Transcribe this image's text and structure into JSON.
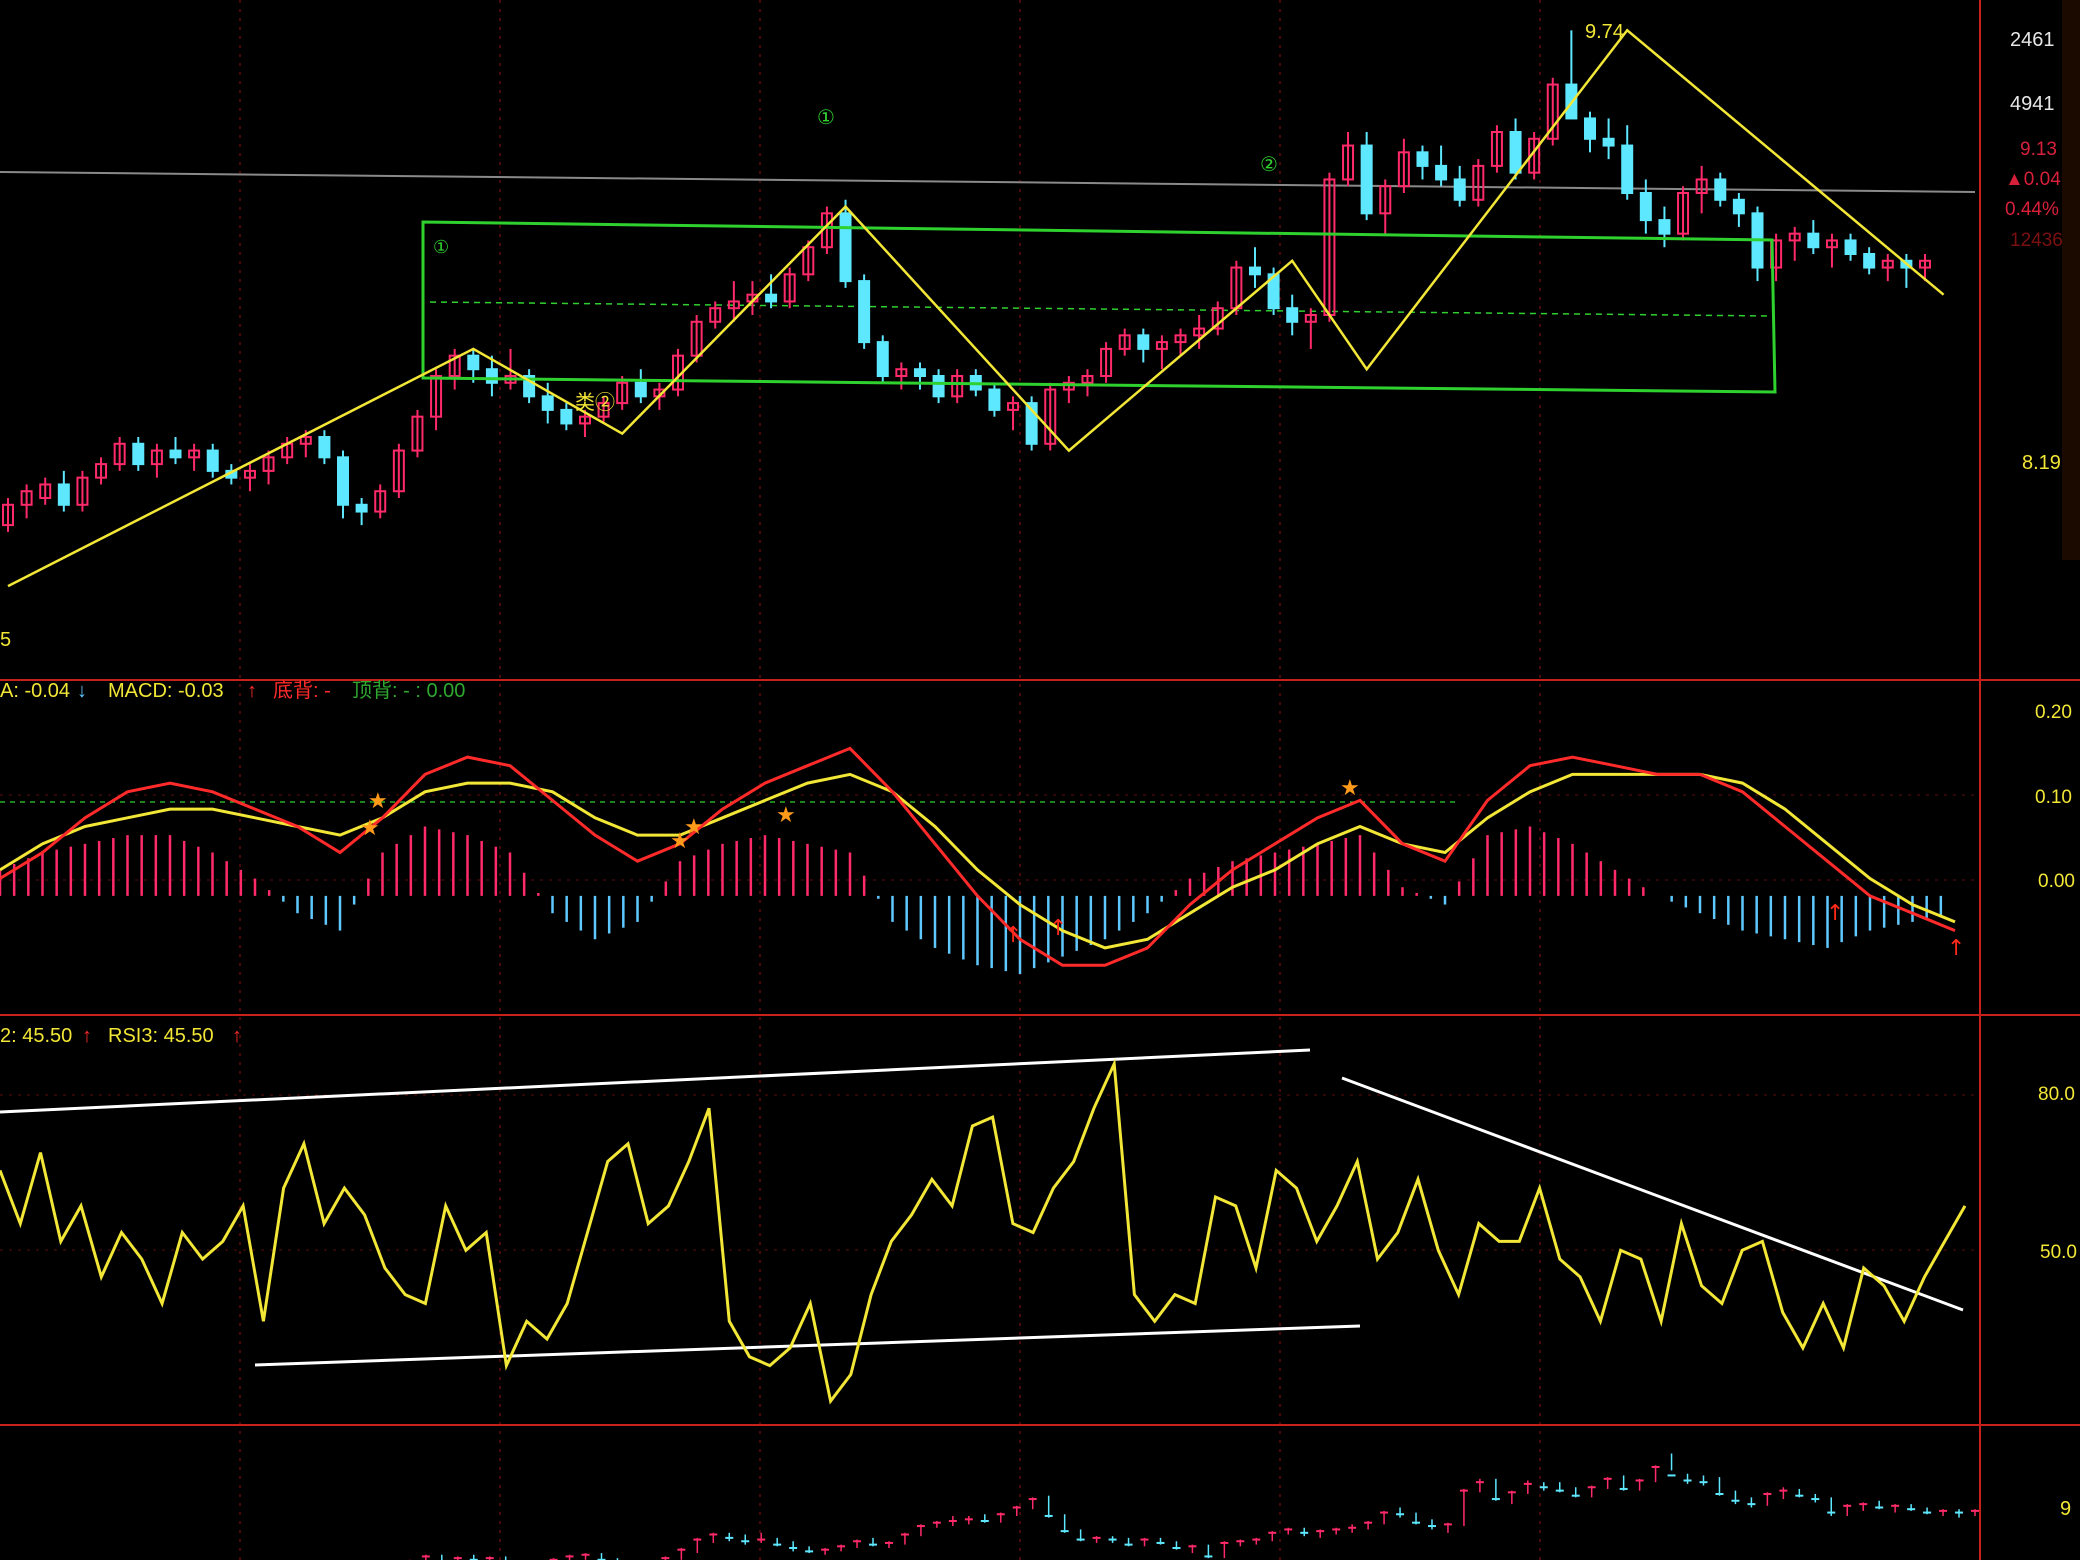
{
  "colors": {
    "background": "#000000",
    "panel_border": "#c8201a",
    "grid": "#5a0c0c",
    "up_candle": "#ff2a6a",
    "down_candle": "#5ee8ff",
    "zigzag": "#f2e636",
    "box": "#2fd12f",
    "dif": "#ff2a2a",
    "dea": "#f2e636",
    "hist_pos": "#ff2a6a",
    "hist_neg": "#5ec8ff",
    "rsi": "#f2e636",
    "trendline": "#ffffff",
    "axis_text": "#f2e636"
  },
  "price_panel": {
    "high_label": "9.74",
    "axis_right": [
      "2461",
      "4941",
      "8.19"
    ],
    "axis_partial": [
      "9.13",
      "▲0.04",
      "0.44%",
      "12436"
    ],
    "wave_labels": [
      "①",
      "①",
      "②",
      "类②"
    ],
    "left_edge_label": "5"
  },
  "macd_panel": {
    "dea_label": "A: -0.04",
    "macd_label": "MACD: -0.03",
    "bottom_div_label": "底背: -",
    "top_div_label": "顶背: - : 0.00",
    "axis": [
      "0.20",
      "0.10",
      "0.00"
    ]
  },
  "rsi_panel": {
    "rsi2_label": "2: 45.50",
    "rsi3_label": "RSI3: 45.50",
    "axis": [
      "80.0",
      "50.0"
    ]
  },
  "volume_panel": {
    "axis": [
      "9"
    ]
  },
  "chart_data": {
    "type": "line",
    "title": "",
    "candles_ohlc": [
      [
        8.28,
        8.36,
        8.26,
        8.34
      ],
      [
        8.34,
        8.4,
        8.3,
        8.38
      ],
      [
        8.36,
        8.42,
        8.34,
        8.4
      ],
      [
        8.4,
        8.44,
        8.32,
        8.34
      ],
      [
        8.34,
        8.44,
        8.32,
        8.42
      ],
      [
        8.42,
        8.48,
        8.4,
        8.46
      ],
      [
        8.46,
        8.54,
        8.44,
        8.52
      ],
      [
        8.52,
        8.54,
        8.44,
        8.46
      ],
      [
        8.46,
        8.52,
        8.42,
        8.5
      ],
      [
        8.5,
        8.54,
        8.46,
        8.48
      ],
      [
        8.48,
        8.52,
        8.44,
        8.5
      ],
      [
        8.5,
        8.52,
        8.42,
        8.44
      ],
      [
        8.44,
        8.46,
        8.4,
        8.42
      ],
      [
        8.42,
        8.46,
        8.38,
        8.44
      ],
      [
        8.44,
        8.5,
        8.4,
        8.48
      ],
      [
        8.48,
        8.54,
        8.46,
        8.52
      ],
      [
        8.52,
        8.56,
        8.48,
        8.54
      ],
      [
        8.54,
        8.56,
        8.46,
        8.48
      ],
      [
        8.48,
        8.5,
        8.3,
        8.34
      ],
      [
        8.34,
        8.36,
        8.28,
        8.32
      ],
      [
        8.32,
        8.4,
        8.3,
        8.38
      ],
      [
        8.38,
        8.52,
        8.36,
        8.5
      ],
      [
        8.5,
        8.62,
        8.48,
        8.6
      ],
      [
        8.6,
        8.74,
        8.56,
        8.72
      ],
      [
        8.72,
        8.8,
        8.68,
        8.78
      ],
      [
        8.78,
        8.8,
        8.7,
        8.74
      ],
      [
        8.74,
        8.78,
        8.66,
        8.7
      ],
      [
        8.7,
        8.8,
        8.68,
        8.72
      ],
      [
        8.72,
        8.74,
        8.64,
        8.66
      ],
      [
        8.66,
        8.7,
        8.58,
        8.62
      ],
      [
        8.62,
        8.64,
        8.56,
        8.58
      ],
      [
        8.58,
        8.62,
        8.54,
        8.6
      ],
      [
        8.6,
        8.66,
        8.58,
        8.64
      ],
      [
        8.64,
        8.72,
        8.62,
        8.7
      ],
      [
        8.7,
        8.74,
        8.64,
        8.66
      ],
      [
        8.66,
        8.7,
        8.62,
        8.68
      ],
      [
        8.68,
        8.8,
        8.66,
        8.78
      ],
      [
        8.78,
        8.9,
        8.76,
        8.88
      ],
      [
        8.88,
        8.94,
        8.86,
        8.92
      ],
      [
        8.92,
        9.0,
        8.88,
        8.94
      ],
      [
        8.94,
        9.0,
        8.9,
        8.96
      ],
      [
        8.96,
        9.02,
        8.92,
        8.94
      ],
      [
        8.94,
        9.04,
        8.92,
        9.02
      ],
      [
        9.02,
        9.12,
        9.0,
        9.1
      ],
      [
        9.1,
        9.22,
        9.08,
        9.2
      ],
      [
        9.2,
        9.24,
        8.98,
        9.0
      ],
      [
        9.0,
        9.02,
        8.8,
        8.82
      ],
      [
        8.82,
        8.84,
        8.7,
        8.72
      ],
      [
        8.72,
        8.76,
        8.68,
        8.74
      ],
      [
        8.74,
        8.76,
        8.68,
        8.72
      ],
      [
        8.72,
        8.74,
        8.64,
        8.66
      ],
      [
        8.66,
        8.74,
        8.64,
        8.72
      ],
      [
        8.72,
        8.74,
        8.66,
        8.68
      ],
      [
        8.68,
        8.7,
        8.6,
        8.62
      ],
      [
        8.62,
        8.66,
        8.56,
        8.64
      ],
      [
        8.64,
        8.66,
        8.5,
        8.52
      ],
      [
        8.52,
        8.7,
        8.5,
        8.68
      ],
      [
        8.68,
        8.72,
        8.64,
        8.7
      ],
      [
        8.7,
        8.74,
        8.66,
        8.72
      ],
      [
        8.72,
        8.82,
        8.7,
        8.8
      ],
      [
        8.8,
        8.86,
        8.78,
        8.84
      ],
      [
        8.84,
        8.86,
        8.76,
        8.8
      ],
      [
        8.8,
        8.84,
        8.74,
        8.82
      ],
      [
        8.82,
        8.86,
        8.78,
        8.84
      ],
      [
        8.84,
        8.9,
        8.8,
        8.86
      ],
      [
        8.86,
        8.94,
        8.84,
        8.92
      ],
      [
        8.92,
        9.06,
        8.9,
        9.04
      ],
      [
        9.04,
        9.1,
        8.98,
        9.02
      ],
      [
        9.02,
        9.04,
        8.9,
        8.92
      ],
      [
        8.92,
        8.96,
        8.84,
        8.88
      ],
      [
        8.88,
        8.92,
        8.8,
        8.9
      ],
      [
        8.9,
        9.32,
        8.88,
        9.3
      ],
      [
        9.3,
        9.44,
        9.28,
        9.4
      ],
      [
        9.4,
        9.44,
        9.18,
        9.2
      ],
      [
        9.2,
        9.3,
        9.14,
        9.28
      ],
      [
        9.28,
        9.42,
        9.26,
        9.38
      ],
      [
        9.38,
        9.4,
        9.3,
        9.34
      ],
      [
        9.34,
        9.4,
        9.28,
        9.3
      ],
      [
        9.3,
        9.34,
        9.22,
        9.24
      ],
      [
        9.24,
        9.36,
        9.22,
        9.34
      ],
      [
        9.34,
        9.46,
        9.32,
        9.44
      ],
      [
        9.44,
        9.48,
        9.3,
        9.32
      ],
      [
        9.32,
        9.44,
        9.3,
        9.42
      ],
      [
        9.42,
        9.6,
        9.4,
        9.58
      ],
      [
        9.58,
        9.74,
        9.54,
        9.48
      ],
      [
        9.48,
        9.5,
        9.38,
        9.42
      ],
      [
        9.42,
        9.48,
        9.36,
        9.4
      ],
      [
        9.4,
        9.46,
        9.24,
        9.26
      ],
      [
        9.26,
        9.3,
        9.14,
        9.18
      ],
      [
        9.18,
        9.22,
        9.1,
        9.14
      ],
      [
        9.14,
        9.28,
        9.12,
        9.26
      ],
      [
        9.26,
        9.34,
        9.2,
        9.3
      ],
      [
        9.3,
        9.32,
        9.22,
        9.24
      ],
      [
        9.24,
        9.26,
        9.16,
        9.2
      ],
      [
        9.2,
        9.22,
        9.0,
        9.04
      ],
      [
        9.04,
        9.14,
        9.0,
        9.12
      ],
      [
        9.12,
        9.16,
        9.06,
        9.14
      ],
      [
        9.14,
        9.18,
        9.08,
        9.1
      ],
      [
        9.1,
        9.14,
        9.04,
        9.12
      ],
      [
        9.12,
        9.14,
        9.06,
        9.08
      ],
      [
        9.08,
        9.1,
        9.02,
        9.04
      ],
      [
        9.04,
        9.08,
        9.0,
        9.06
      ],
      [
        9.06,
        9.08,
        8.98,
        9.04
      ],
      [
        9.04,
        9.08,
        9.0,
        9.06
      ]
    ],
    "zigzag_prices": [
      8.1,
      8.8,
      8.55,
      9.22,
      8.5,
      9.06,
      8.74,
      9.74,
      8.96
    ],
    "zigzag_index": [
      0,
      25,
      33,
      45,
      57,
      69,
      73,
      87,
      104
    ],
    "macd_dif": [
      0.02,
      0.05,
      0.09,
      0.12,
      0.13,
      0.12,
      0.1,
      0.08,
      0.05,
      0.09,
      0.14,
      0.16,
      0.15,
      0.11,
      0.07,
      0.04,
      0.06,
      0.1,
      0.13,
      0.15,
      0.17,
      0.12,
      0.06,
      0.0,
      -0.05,
      -0.08,
      -0.08,
      -0.06,
      -0.01,
      0.03,
      0.06,
      0.09,
      0.11,
      0.06,
      0.04,
      0.11,
      0.15,
      0.16,
      0.15,
      0.14,
      0.14,
      0.12,
      0.08,
      0.04,
      0.0,
      -0.02,
      -0.04
    ],
    "macd_dea": [
      0.03,
      0.06,
      0.08,
      0.09,
      0.1,
      0.1,
      0.09,
      0.08,
      0.07,
      0.09,
      0.12,
      0.13,
      0.13,
      0.12,
      0.09,
      0.07,
      0.07,
      0.09,
      0.11,
      0.13,
      0.14,
      0.12,
      0.08,
      0.03,
      -0.01,
      -0.04,
      -0.06,
      -0.05,
      -0.02,
      0.01,
      0.03,
      0.06,
      0.08,
      0.06,
      0.05,
      0.09,
      0.12,
      0.14,
      0.14,
      0.14,
      0.14,
      0.13,
      0.1,
      0.06,
      0.02,
      -0.01,
      -0.03
    ],
    "macd_hist": [
      0.03,
      0.05,
      0.06,
      0.07,
      0.07,
      0.05,
      0.02,
      -0.02,
      -0.04,
      0.05,
      0.08,
      0.07,
      0.05,
      -0.02,
      -0.05,
      -0.03,
      0.04,
      0.06,
      0.07,
      0.06,
      0.05,
      -0.03,
      -0.06,
      -0.08,
      -0.09,
      -0.07,
      -0.05,
      -0.02,
      0.02,
      0.04,
      0.05,
      0.06,
      0.07,
      0.01,
      -0.01,
      0.07,
      0.08,
      0.06,
      0.03,
      0.0,
      -0.02,
      -0.04,
      -0.05,
      -0.06,
      -0.04,
      -0.03,
      -0.02
    ],
    "rsi": [
      74,
      62,
      78,
      58,
      66,
      50,
      60,
      54,
      44,
      60,
      54,
      58,
      66,
      40,
      70,
      80,
      62,
      70,
      64,
      52,
      46,
      44,
      66,
      56,
      60,
      30,
      40,
      36,
      44,
      60,
      76,
      80,
      62,
      66,
      76,
      88,
      40,
      32,
      30,
      34,
      44,
      22,
      28,
      46,
      58,
      64,
      72,
      66,
      84,
      86,
      62,
      60,
      70,
      76,
      88,
      98,
      46,
      40,
      46,
      44,
      68,
      66,
      52,
      74,
      70,
      58,
      66,
      76,
      54,
      60,
      72,
      56,
      46,
      62,
      58,
      58,
      70,
      54,
      50,
      40,
      56,
      54,
      40,
      62,
      48,
      44,
      56,
      58,
      42,
      34,
      44,
      34,
      52,
      48,
      40,
      50,
      58,
      66
    ],
    "rsi_ylim": [
      20,
      100
    ],
    "price_ylim": [
      8.0,
      9.8
    ],
    "macd_ylim": [
      -0.12,
      0.22
    ],
    "grid": true
  }
}
